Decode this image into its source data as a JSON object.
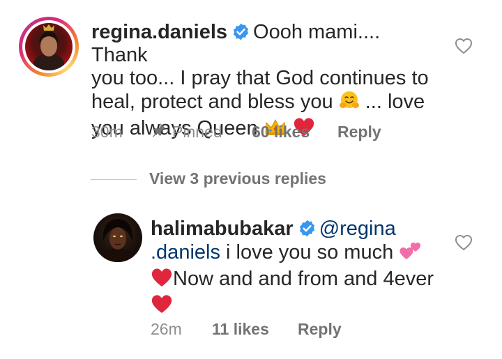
{
  "comments": [
    {
      "username": "regina.daniels",
      "verified": true,
      "text_line1": "Oooh mami.... Thank",
      "text_line2": "you too... I pray that God continues to",
      "text_line3a": "heal, protect and bless you",
      "text_line3b": "... love",
      "text_line4": "you always Queen",
      "time": "30m",
      "pinned_label": "Pinned",
      "likes": "60 likes",
      "reply_label": "Reply"
    },
    {
      "username": "halimabubakar",
      "verified": true,
      "mention_part1": "@regina",
      "mention_part2": ".daniels",
      "text_line2": " i love you so much",
      "text_line3": "Now and and from and 4ever",
      "time": "26m",
      "likes": "11 likes",
      "reply_label": "Reply"
    }
  ],
  "view_replies_label": "View 3 previous replies",
  "icons": {
    "verified": "verified-badge-icon",
    "like": "heart-outline-icon",
    "pin": "pin-icon",
    "emoji_hug": "hugging-face-emoji",
    "emoji_crown": "crown-emoji",
    "emoji_heart": "red-heart-emoji",
    "emoji_two_hearts": "two-hearts-emoji"
  },
  "colors": {
    "verified_blue": "#3897f0",
    "mention": "#00376b",
    "meta_gray": "#8e8e8e",
    "heart_red": "#e0263c"
  }
}
